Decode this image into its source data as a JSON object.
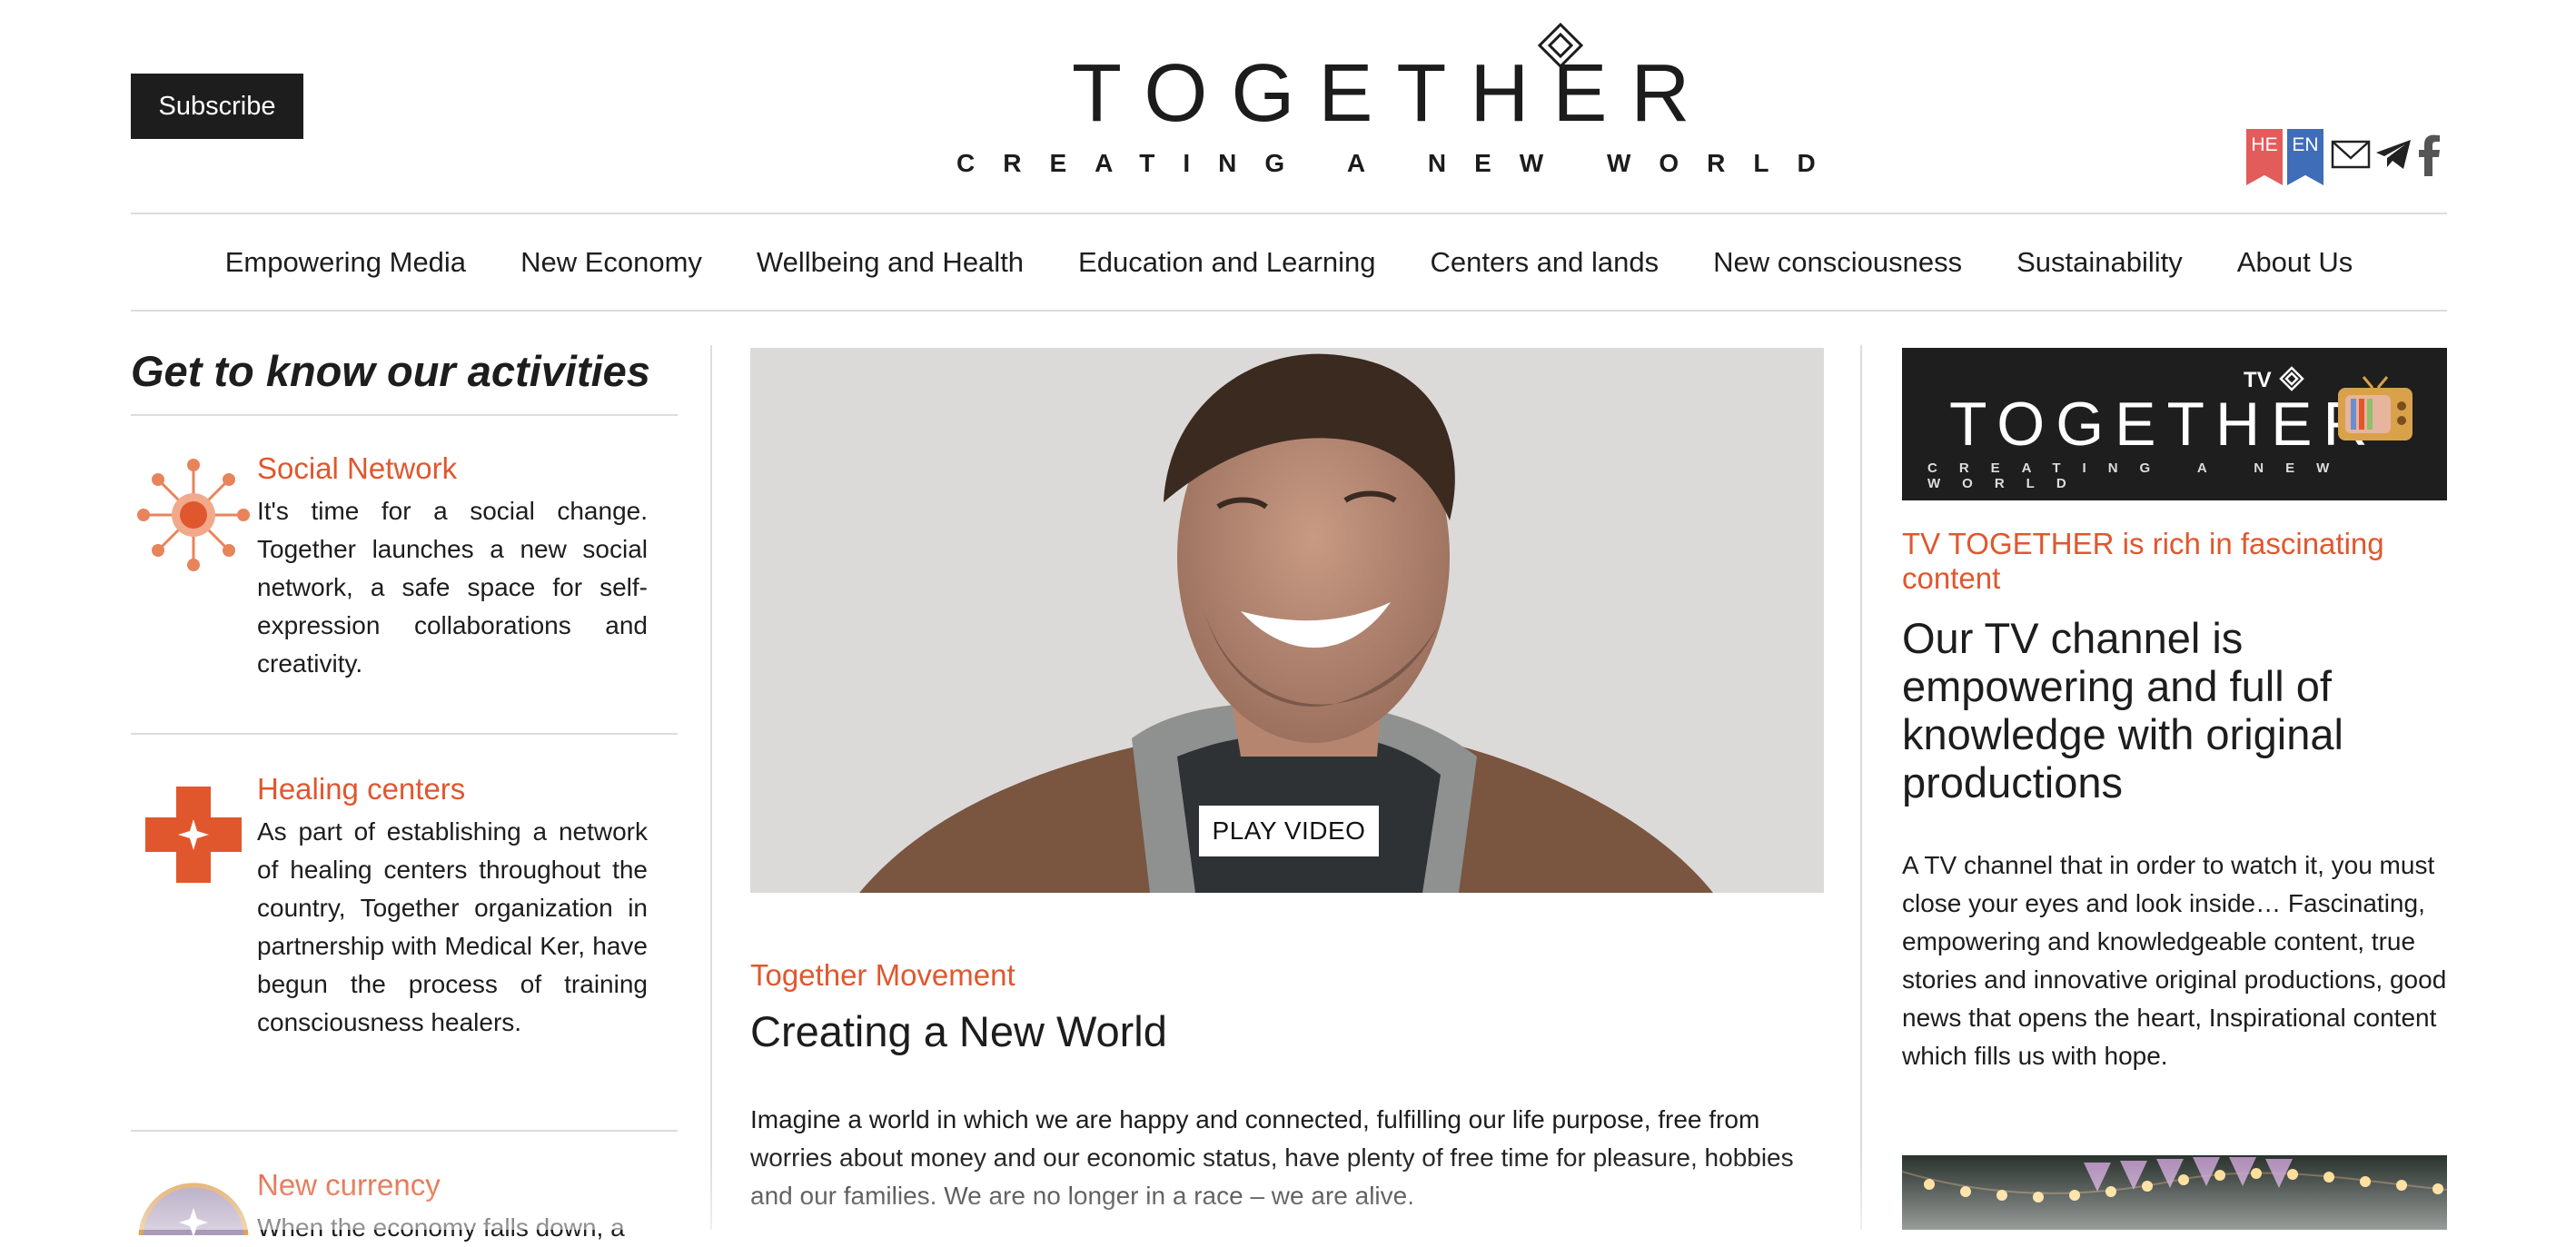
{
  "header": {
    "subscribe_label": "Subscribe",
    "logo_text": "TOGETHER",
    "tagline": "CREATING A NEW WORLD",
    "languages": [
      "HE",
      "EN"
    ],
    "social_icons": [
      "mail-icon",
      "telegram-icon",
      "facebook-icon"
    ]
  },
  "nav": {
    "items": [
      "Empowering Media",
      "New Economy",
      "Wellbeing and Health",
      "Education and Learning",
      "Centers and lands",
      "New consciousness",
      "Sustainability",
      "About Us"
    ]
  },
  "activities": {
    "title": "Get to know our activities",
    "items": [
      {
        "icon": "network-icon",
        "title": "Social Network",
        "text": "It's time for a social change. Together launches a new social network, a safe space for self-expression collaborations and creativity."
      },
      {
        "icon": "medical-cross-icon",
        "title": "Healing centers",
        "text": "As part of establishing a network of healing centers throughout the country, Together organization in partnership with Medical Ker, have begun the process of training consciousness healers."
      },
      {
        "icon": "currency-icon",
        "title": "New currency",
        "text": "When the economy falls down, a"
      }
    ]
  },
  "feature": {
    "play_label": "PLAY VIDEO",
    "kicker": "Together Movement",
    "headline": "Creating a New World",
    "body": "Imagine a world in which we are happy and connected, fulfilling our life purpose, free from worries about money and our economic status, have plenty of free time for pleasure, hobbies and our families. We are no longer in a race – we are alive."
  },
  "tv": {
    "banner_tv": "TV",
    "banner_logo": "TOGETHER",
    "banner_tagline": "CREATING A NEW WORLD",
    "kicker": "TV TOGETHER is rich in fascinating content",
    "headline": "Our TV channel is empowering and full of knowledge with original productions",
    "body": "A TV channel that in order to watch it, you must close your eyes and look inside… Fascinating, empowering and knowledgeable content, true stories and innovative original productions, good news that opens the heart, Inspirational content which fills us with hope."
  },
  "colors": {
    "accent": "#e0572e",
    "lang_he": "#e25c5c",
    "lang_en": "#3f6db8",
    "dark": "#1d1d1d"
  }
}
